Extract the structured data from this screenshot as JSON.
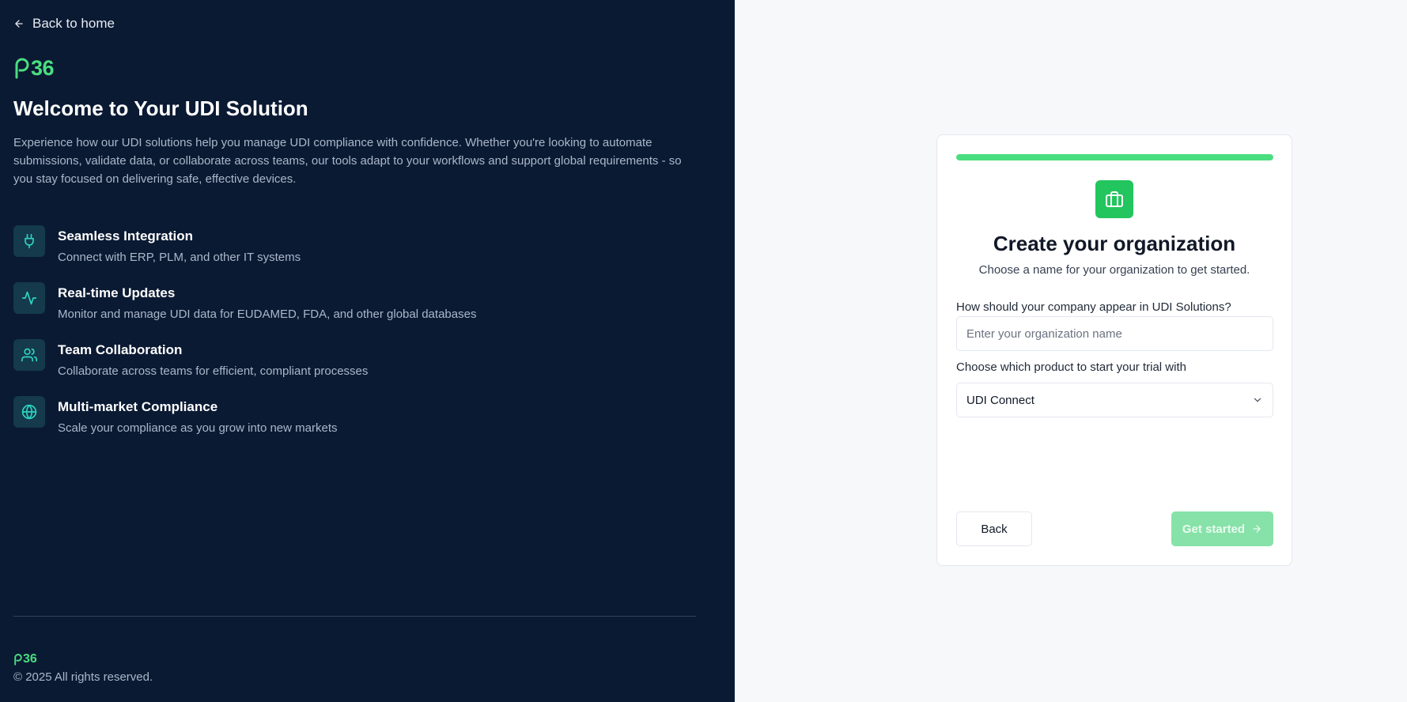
{
  "left": {
    "back_label": "Back to home",
    "logo_text": "36",
    "title": "Welcome to Your UDI Solution",
    "intro": "Experience how our UDI solutions help you manage UDI compliance with confidence. Whether you're looking to automate submissions, validate data, or collaborate across teams, our tools adapt to your workflows and support global requirements - so you stay focused on delivering safe, effective devices.",
    "features": [
      {
        "icon": "plug-icon",
        "title": "Seamless Integration",
        "description": "Connect with ERP, PLM, and other IT systems"
      },
      {
        "icon": "activity-icon",
        "title": "Real-time Updates",
        "description": "Monitor and manage UDI data for EUDAMED, FDA, and other global databases"
      },
      {
        "icon": "users-icon",
        "title": "Team Collaboration",
        "description": "Collaborate across teams for efficient, compliant processes"
      },
      {
        "icon": "globe-icon",
        "title": "Multi-market Compliance",
        "description": "Scale your compliance as you grow into new markets"
      }
    ],
    "footer_logo_text": "36",
    "copyright": "© 2025 All rights reserved."
  },
  "card": {
    "progress": 1.0,
    "icon": "briefcase-icon",
    "title": "Create your organization",
    "subtitle": "Choose a name for your organization to get started.",
    "org_label": "How should your company appear in UDI Solutions?",
    "org_placeholder": "Enter your organization name",
    "org_value": "",
    "product_label": "Choose which product to start your trial with",
    "product_selected": "UDI Connect",
    "back_button": "Back",
    "start_button": "Get started"
  },
  "colors": {
    "left_bg": "#0b1a33",
    "accent_green": "#22c55e",
    "logo_green": "#4ade80",
    "disabled_green": "#86e2a8",
    "icon_tile_bg": "#143a4c"
  }
}
